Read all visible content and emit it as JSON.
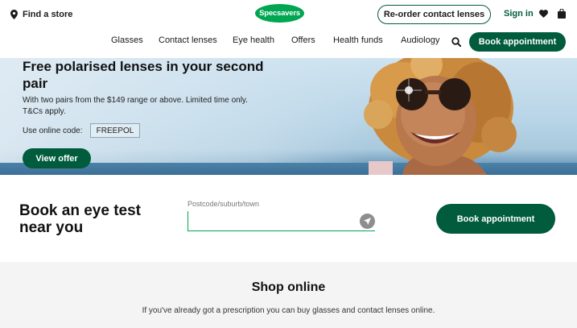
{
  "header": {
    "find_store": "Find a store",
    "logo_text": "Specsavers",
    "reorder_label": "Re-order contact lenses",
    "signin_label": "Sign in",
    "icons": [
      "pin-icon",
      "heart-icon",
      "bag-icon",
      "search-icon"
    ]
  },
  "nav": {
    "items": [
      "Glasses",
      "Contact lenses",
      "Eye health",
      "Offers",
      "Health funds",
      "Audiology"
    ],
    "book_label": "Book appointment"
  },
  "hero": {
    "title": "Free polarised lenses in your second pair",
    "subtitle": "With two pairs from the $149 range or above. Limited time only. T&Cs apply.",
    "code_label": "Use online code:",
    "code": "FREEPOL",
    "cta": "View offer"
  },
  "booking": {
    "heading": "Book an eye test near you",
    "field_label": "Postcode/suburb/town",
    "field_value": "",
    "button_label": "Book appointment"
  },
  "shop": {
    "title": "Shop online",
    "subtitle": "If you've already got a prescription you can buy glasses and contact lenses online."
  },
  "colors": {
    "brand_green": "#005c3d",
    "logo_green": "#00a651",
    "shop_bg": "#f4f4f4"
  }
}
